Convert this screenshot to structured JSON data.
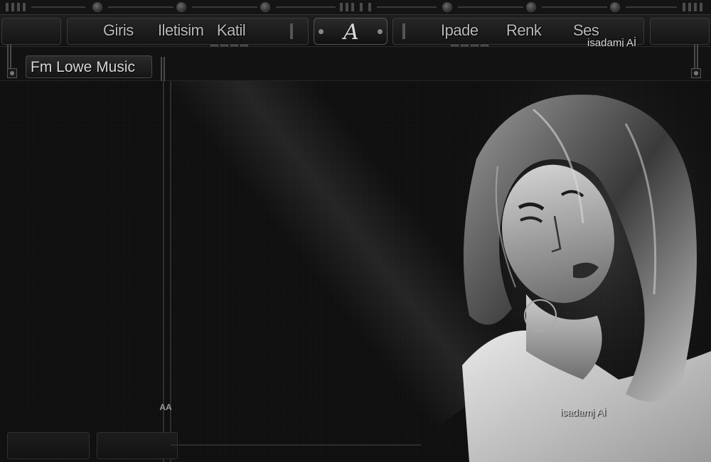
{
  "nav": {
    "left_links": [
      "Giris",
      "Iletisim",
      "Katil"
    ],
    "right_links": [
      "Ipade",
      "Renk",
      "Ses"
    ],
    "logo_letter": "A"
  },
  "watermark": "isadamj Aİ",
  "title": "Fm Lowe Music",
  "scroll_marker": "AA",
  "colors": {
    "background": "#0b0b0b",
    "panel": "#1a1a1a",
    "text": "#cfcfcf",
    "border": "#3a3a3a"
  },
  "icons": [
    "logo-a-icon",
    "rail-knob-icon",
    "divider-grip-icon"
  ]
}
